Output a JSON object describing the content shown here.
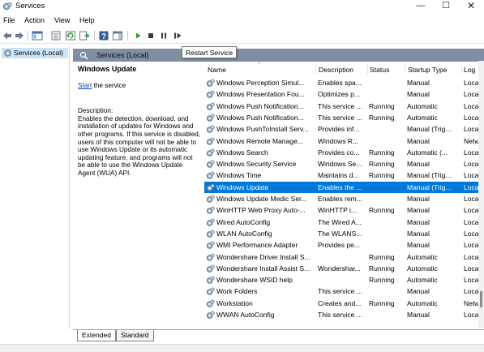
{
  "window": {
    "title": "Services",
    "controls": {
      "minimize": "—",
      "maximize": "☐",
      "close": "✕"
    }
  },
  "menu": [
    "File",
    "Action",
    "View",
    "Help"
  ],
  "toolbar": {
    "buttons": [
      "back-arrow-icon",
      "forward-arrow-icon",
      "console-tree-icon",
      "properties-icon",
      "refresh-icon",
      "export-list-icon",
      "help-icon",
      "show-hide-icon",
      "start-service-icon",
      "stop-service-icon",
      "pause-service-icon",
      "restart-service-icon"
    ]
  },
  "tooltip": "Restart Service",
  "tree": {
    "item": "Services (Local)"
  },
  "pane": {
    "header": "Services (Local)",
    "selected_service": "Windows Update",
    "start_link": "Start",
    "start_suffix": " the service",
    "description_label": "Description:",
    "description_text": "Enables the detection, download, and installation of updates for Windows and other programs. If this service is disabled, users of this computer will not be able to use Windows Update or its automatic updating feature, and programs will not be able to use the Windows Update Agent (WUA) API."
  },
  "table": {
    "columns": [
      "Name",
      "Description",
      "Status",
      "Startup Type",
      "Log"
    ],
    "rows": [
      [
        "Windows Perception Simul...",
        "Enables spa...",
        "",
        "Manual",
        "Loca"
      ],
      [
        "Windows Presentation Fou...",
        "Optimizes p...",
        "",
        "Manual",
        "Loca"
      ],
      [
        "Windows Push Notification...",
        "This service ...",
        "Running",
        "Automatic",
        "Loca"
      ],
      [
        "Windows Push Notification...",
        "This service ...",
        "Running",
        "Automatic",
        "Loca"
      ],
      [
        "Windows PushToInstall Serv...",
        "Provides inf...",
        "",
        "Manual (Trig...",
        "Loca"
      ],
      [
        "Windows Remote Manage...",
        "Windows R...",
        "",
        "Manual",
        "Netw"
      ],
      [
        "Windows Search",
        "Provides co...",
        "Running",
        "Automatic (...",
        "Loca"
      ],
      [
        "Windows Security Service",
        "Windows Se...",
        "Running",
        "Manual",
        "Loca"
      ],
      [
        "Windows Time",
        "Maintains d...",
        "Running",
        "Manual (Trig...",
        "Loca"
      ],
      [
        "Windows Update",
        "Enables the ...",
        "",
        "Manual (Trig...",
        "Loca"
      ],
      [
        "Windows Update Medic Ser...",
        "Enables rem...",
        "",
        "Manual",
        "Loca"
      ],
      [
        "WinHTTP Web Proxy Auto-...",
        "WinHTTP i...",
        "Running",
        "Manual",
        "Loca"
      ],
      [
        "Wired AutoConfig",
        "The Wired A...",
        "",
        "Manual",
        "Loca"
      ],
      [
        "WLAN AutoConfig",
        "The WLANS...",
        "",
        "Manual",
        "Loca"
      ],
      [
        "WMI Performance Adapter",
        "Provides pe...",
        "",
        "Manual",
        "Loca"
      ],
      [
        "Wondershare Driver Install S...",
        "",
        "Running",
        "Automatic",
        "Loca"
      ],
      [
        "Wondershare Install Assist S...",
        "Wondershar...",
        "Running",
        "Automatic",
        "Loca"
      ],
      [
        "Wondershare WSID help",
        "",
        "Running",
        "Automatic",
        "Loca"
      ],
      [
        "Work Folders",
        "This service ...",
        "",
        "Manual",
        "Loca"
      ],
      [
        "Workstation",
        "Creates and...",
        "Running",
        "Automatic",
        "Netw"
      ],
      [
        "WWAN AutoConfig",
        "This service ...",
        "",
        "Manual",
        "Loca"
      ]
    ],
    "selected_index": 9
  },
  "tabs": [
    "Extended",
    "Standard"
  ],
  "colors": {
    "selection": "#0078d7",
    "pane_header": "#7f8ea3",
    "tree_selection": "#cce4f7",
    "play_green": "#2a9d2a"
  }
}
